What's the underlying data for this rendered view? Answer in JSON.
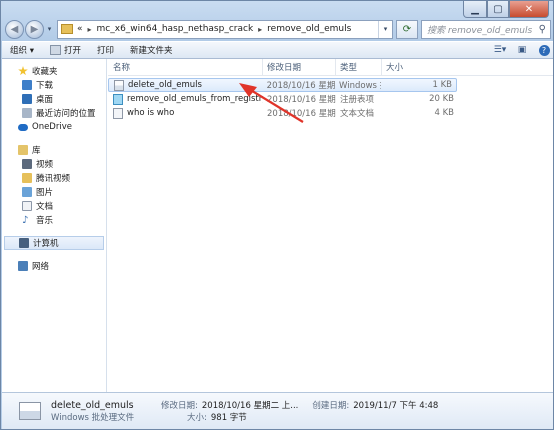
{
  "address": {
    "crumbs": [
      "mc_x6_win64_hasp_nethasp_crack",
      "remove_old_emuls"
    ],
    "prefix": "«"
  },
  "search": {
    "placeholder": "搜索 remove_old_emuls"
  },
  "toolbar": {
    "organize": "组织 ▾",
    "open": "打开",
    "print": "打印",
    "new_folder": "新建文件夹"
  },
  "nav": {
    "favorites": "收藏夹",
    "downloads": "下载",
    "desktop": "桌面",
    "recent": "最近访问的位置",
    "onedrive": "OneDrive",
    "libraries": "库",
    "videos": "视频",
    "tencent_video": "腾讯视频",
    "pictures": "图片",
    "documents": "文档",
    "music": "音乐",
    "computer": "计算机",
    "network": "网络"
  },
  "columns": {
    "name": "名称",
    "modified": "修改日期",
    "type": "类型",
    "size": "大小"
  },
  "files": [
    {
      "name": "delete_old_emuls",
      "modified": "2018/10/16 星期...",
      "type": "Windows 批处理...",
      "size": "1 KB",
      "icon": "batch-file-icon"
    },
    {
      "name": "remove_old_emuls_from_registry",
      "modified": "2018/10/16 星期...",
      "type": "注册表项",
      "size": "20 KB",
      "icon": "registry-file-icon"
    },
    {
      "name": "who is who",
      "modified": "2018/10/16 星期...",
      "type": "文本文档",
      "size": "4 KB",
      "icon": "text-file-icon"
    }
  ],
  "details": {
    "name": "delete_old_emuls",
    "kind": "Windows 批处理文件",
    "modified_label": "修改日期:",
    "modified_value": "2018/10/16 星期二 上...",
    "created_label": "创建日期:",
    "created_value": "2019/11/7 下午 4:48",
    "size_label": "大小:",
    "size_value": "981 字节"
  },
  "colors": {
    "selection": "#dceafb",
    "arrow": "#e0342a",
    "frame": "#b5cde8"
  }
}
